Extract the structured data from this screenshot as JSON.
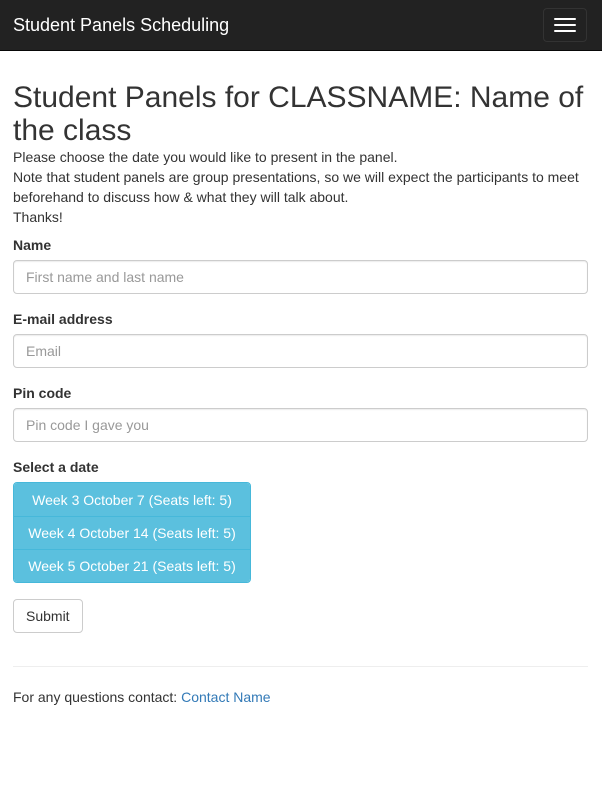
{
  "navbar": {
    "brand": "Student Panels Scheduling",
    "toggle_icon": "hamburger-menu-icon"
  },
  "main": {
    "title": "Student Panels for CLASSNAME: Name of the class",
    "intro": "Please choose the date you would like to present in the panel.",
    "note": "Note that student panels are group presentations, so we will expect the participants to meet beforehand to discuss how & what they will talk about.",
    "thanks": "Thanks!"
  },
  "form": {
    "name": {
      "label": "Name",
      "placeholder": "First name and last name",
      "value": ""
    },
    "email": {
      "label": "E-mail address",
      "placeholder": "Email",
      "value": ""
    },
    "pin": {
      "label": "Pin code",
      "placeholder": "Pin code I gave you",
      "value": ""
    },
    "date": {
      "label": "Select a date",
      "options": [
        "Week 3 October 7 (Seats left: 5)",
        "Week 4 October 14 (Seats left: 5)",
        "Week 5 October 21 (Seats left: 5)"
      ]
    },
    "submit_label": "Submit"
  },
  "footer": {
    "text": "For any questions contact: ",
    "contact_link": "Contact Name"
  },
  "colors": {
    "navbar_bg": "#222222",
    "info_button": "#5bc0de",
    "link": "#337ab7"
  }
}
